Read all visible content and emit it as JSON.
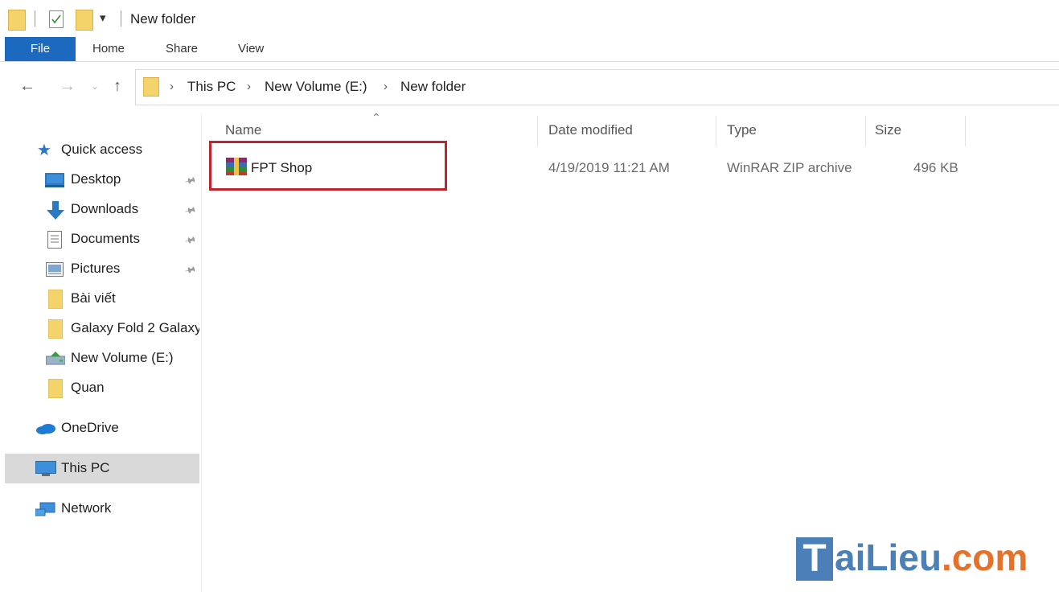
{
  "window": {
    "title": "New folder"
  },
  "ribbon": {
    "tabs": [
      "File",
      "Home",
      "Share",
      "View"
    ]
  },
  "address": {
    "breadcrumbs": [
      "This PC",
      "New Volume (E:)",
      "New folder"
    ]
  },
  "navigation": {
    "items": [
      {
        "label": "Quick access",
        "icon": "star-icon"
      },
      {
        "label": "Desktop",
        "icon": "desktop-icon",
        "pinned": true
      },
      {
        "label": "Downloads",
        "icon": "download-arrow-icon",
        "pinned": true
      },
      {
        "label": "Documents",
        "icon": "document-icon",
        "pinned": true
      },
      {
        "label": "Pictures",
        "icon": "pictures-icon",
        "pinned": true
      },
      {
        "label": "Bài viết",
        "icon": "folder-icon"
      },
      {
        "label": "Galaxy Fold 2 Galaxy",
        "icon": "folder-icon"
      },
      {
        "label": "New Volume (E:)",
        "icon": "drive-icon"
      },
      {
        "label": "Quan",
        "icon": "folder-icon"
      },
      {
        "label": "OneDrive",
        "icon": "cloud-icon"
      },
      {
        "label": "This PC",
        "icon": "computer-icon",
        "selected": true
      },
      {
        "label": "Network",
        "icon": "network-icon"
      }
    ]
  },
  "file_list": {
    "columns": [
      "Name",
      "Date modified",
      "Type",
      "Size"
    ],
    "rows": [
      {
        "name": "FPT Shop",
        "date_modified": "4/19/2019 11:21 AM",
        "type": "WinRAR ZIP archive",
        "size": "496 KB",
        "icon": "winrar-archive-icon"
      }
    ]
  },
  "watermark": {
    "first": "T",
    "middle": "aiLieu",
    "suffix": ".com"
  },
  "colors": {
    "accent": "#1b6ac0",
    "highlight_border": "#c0252b",
    "folder": "#f5d36b",
    "selected_bg": "#d9d9d9"
  }
}
